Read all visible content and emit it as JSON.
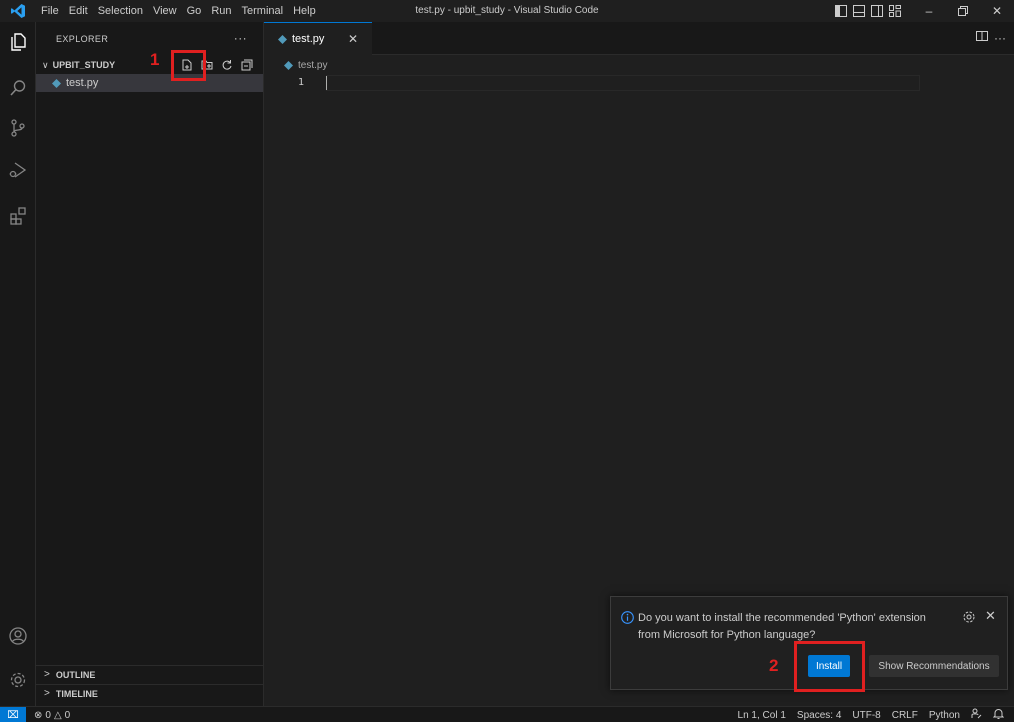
{
  "title_bar": {
    "menu": [
      "File",
      "Edit",
      "Selection",
      "View",
      "Go",
      "Run",
      "Terminal",
      "Help"
    ],
    "window_title": "test.py - upbit_study - Visual Studio Code"
  },
  "sidebar": {
    "header": "EXPLORER",
    "more": "···",
    "folder_name": "UPBIT_STUDY",
    "files": [
      {
        "name": "test.py",
        "icon": "python-file-icon"
      }
    ],
    "sections": [
      "OUTLINE",
      "TIMELINE"
    ]
  },
  "editor": {
    "tab_label": "test.py",
    "breadcrumb": "test.py",
    "line_numbers": [
      "1"
    ]
  },
  "notification": {
    "message": "Do you want to install the recommended 'Python' extension from Microsoft for Python language?",
    "install_label": "Install",
    "recommendations_label": "Show Recommendations"
  },
  "status_bar": {
    "errors": "0",
    "warnings": "0",
    "position": "Ln 1, Col 1",
    "spaces": "Spaces: 4",
    "encoding": "UTF-8",
    "eol": "CRLF",
    "language": "Python"
  },
  "annotations": {
    "marker_1": "1",
    "marker_2": "2"
  },
  "colors": {
    "accent": "#0078d4",
    "annotation": "#e02020",
    "python_icon": "#519aba"
  }
}
